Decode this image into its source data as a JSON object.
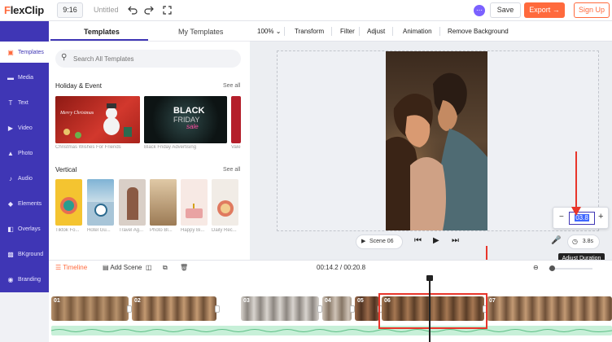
{
  "app": {
    "logo_first": "F",
    "logo_rest": "lexClip"
  },
  "topbar": {
    "ratio": "9:16",
    "doc_title": "Untitled",
    "save": "Save",
    "export": "Export →",
    "signup": "Sign Up"
  },
  "rail": {
    "items": [
      {
        "label": "Templates",
        "icon": "templates-icon"
      },
      {
        "label": "Media",
        "icon": "media-icon"
      },
      {
        "label": "Text",
        "icon": "text-icon"
      },
      {
        "label": "Video",
        "icon": "video-icon"
      },
      {
        "label": "Photo",
        "icon": "photo-icon"
      },
      {
        "label": "Audio",
        "icon": "audio-icon"
      },
      {
        "label": "Elements",
        "icon": "elements-icon"
      },
      {
        "label": "Overlays",
        "icon": "overlays-icon"
      },
      {
        "label": "BKground",
        "icon": "background-icon"
      },
      {
        "label": "Branding",
        "icon": "branding-icon"
      }
    ]
  },
  "panel": {
    "tabs": [
      "Templates",
      "My Templates"
    ],
    "search_placeholder": "Search All Templates",
    "holiday": {
      "title": "Holiday & Event",
      "see_all": "See all",
      "items": [
        "Christmas Wishes For Friends",
        "Black Friday Advertising",
        "Vale"
      ],
      "thumb_text": {
        "christmas": "Merry Christmas",
        "bf_1": "BLACK",
        "bf_2": "FRIDAY",
        "bf_3": "sale"
      }
    },
    "vertical": {
      "title": "Vertical",
      "see_all": "See all",
      "items": [
        "Tiktok Fo...",
        "Hotel Gu...",
        "Travel Ag...",
        "Photo Bl...",
        "Happy Bi...",
        "Daily Rec..."
      ]
    }
  },
  "toolbar": {
    "zoom": "100%",
    "items": [
      "Transform",
      "Filter",
      "Adjust",
      "Animation",
      "Remove Background"
    ]
  },
  "player": {
    "scene": "Scene 06",
    "duration": "3.8s"
  },
  "duration_popup": {
    "minus": "−",
    "value": "03.8",
    "plus": "+"
  },
  "tooltip": "Adjust Duration",
  "timeline": {
    "label": "Timeline",
    "add_scene": "Add Scene",
    "time": "00:14.2 / 00:20.8",
    "zoom_level": 0.05,
    "clips": [
      "01",
      "02",
      "03",
      "04",
      "05",
      "06",
      "07"
    ]
  },
  "colors": {
    "accent": "#ff6a3d",
    "rail": "#3f36b5",
    "annotation": "#e8352b"
  }
}
